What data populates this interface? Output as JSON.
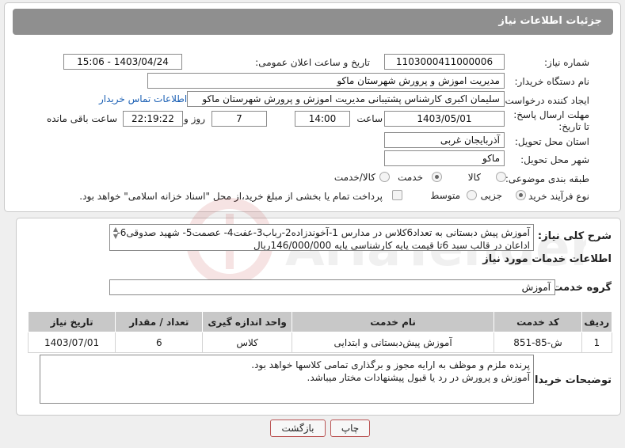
{
  "header": {
    "title": "جزئیات اطلاعات نیاز"
  },
  "form": {
    "need_number_label": "شماره نیاز:",
    "need_number": "1103000411000006",
    "announce_label": "تاریخ و ساعت اعلان عمومی:",
    "announce_value": "1403/04/24 - 15:06",
    "buyer_org_label": "نام دستگاه خریدار:",
    "buyer_org": "مدیریت اموزش و پرورش شهرستان ماکو",
    "creator_label": "ایجاد کننده درخواست:",
    "creator": "سلیمان  اکبری کارشناس پشتیبانی مدیریت اموزش و پرورش شهرستان ماکو",
    "contact_link": "اطلاعات تماس خریدار",
    "deadline_label": "مهلت ارسال پاسخ: تا تاریخ:",
    "deadline_date": "1403/05/01",
    "time_label": "ساعت",
    "deadline_time": "14:00",
    "days_count": "7",
    "days_label": "روز و",
    "remaining_time": "22:19:22",
    "remaining_label": "ساعت باقی مانده",
    "province_label": "استان محل تحویل:",
    "province": "آذربایجان غربی",
    "city_label": "شهر محل تحویل:",
    "city": "ماکو",
    "category_label": "طبقه بندی موضوعی:",
    "category_options": [
      "کالا",
      "خدمت",
      "کالا/خدمت"
    ],
    "category_selected": "خدمت",
    "process_label": "نوع فرآیند خرید :",
    "process_options": [
      "جزیی",
      "متوسط"
    ],
    "process_selected": "جزیی",
    "payment_note": "پرداخت تمام یا بخشی از مبلغ خرید،از محل \"اسناد خزانه اسلامی\" خواهد بود."
  },
  "summary": {
    "label": "شرح کلی نیاز:",
    "line1": "آموزش پیش دبستانی به تعداد6کلاس در مدارس 1-آخوندزاده2-رباب3-عفت4- عصمت5- شهید صدوقی6-",
    "line2": "اداعان در قالب سبد 6تا قیمت پایه کارشناسی پایه 146/000/000ریال"
  },
  "services": {
    "section_title": "اطلاعات خدمات مورد نیاز",
    "group_label": "گروه خدمت:",
    "group_value": "آموزش",
    "columns": [
      "ردیف",
      "کد خدمت",
      "نام خدمت",
      "واحد اندازه گیری",
      "تعداد / مقدار",
      "تاریخ نیاز"
    ],
    "rows": [
      [
        "1",
        "ش-85-851",
        "آموزش پیش‌دبستانی و ابتدایی",
        "کلاس",
        "6",
        "1403/07/01"
      ]
    ]
  },
  "buyer_notes": {
    "label": "توضیحات خریدار:",
    "line1": "پرنده ملزم و موظف به ارایه مجوز و برگذاری تمامی کلاسها خواهد بود.",
    "line2": "آموزش و پرورش در رد یا قبول پیشنهادات مختار میباشد."
  },
  "buttons": {
    "print": "چاپ",
    "back": "بازگشت"
  },
  "watermark": {
    "text": "AriaTender.neT"
  },
  "colors": {
    "header_bg": "#8f8f8f",
    "link": "#1a5fb4",
    "button_border": "#bb5555"
  }
}
